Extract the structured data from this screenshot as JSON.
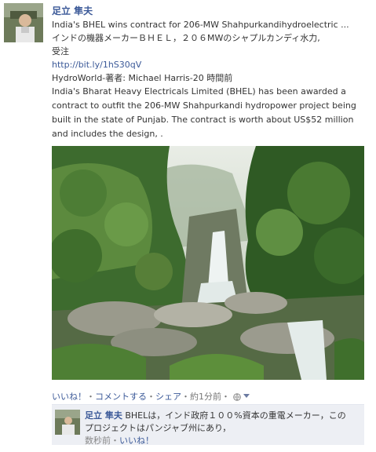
{
  "author": {
    "name": "足立 隼夫"
  },
  "post": {
    "link_title": "India's BHEL wins contract for 206-MW Shahpurkandihydroelectric ...",
    "jp_line1": "インドの機器メーカーＢＨＥＬ，２０６MWのシャプルカンディ水力,",
    "jp_line2": "受注",
    "url": "http://bit.ly/1hS30qV",
    "source": "HydroWorld-著者: Michael Harris-20 時間前",
    "summary": "India's Bharat Heavy Electricals Limited (BHEL) has been awarded a contract to outfit the 206-MW Shahpurkandi hydropower project being built in the state of Punjab. The contract is worth about US$52 million and includes the design, ."
  },
  "actions": {
    "like": "いいね！",
    "sep1": "・",
    "comment": "コメントする",
    "sep2": "・",
    "share": "シェア",
    "sep3": "・",
    "time": "約1分前",
    "sep4": "・",
    "audience_icon": "globe-icon",
    "dropdown_icon": "chevron-down-icon"
  },
  "comment": {
    "name": "足立 隼夫",
    "text_line1": "BHELは，インド政府１００%資本の重電メーカー，この",
    "text_line2": "プロジェクトはパンジャブ州にあり，",
    "time": "数秒前",
    "sep": "・",
    "like": "いいね！"
  },
  "colors": {
    "link": "#3b5998",
    "comment_bg": "#edeff4"
  }
}
